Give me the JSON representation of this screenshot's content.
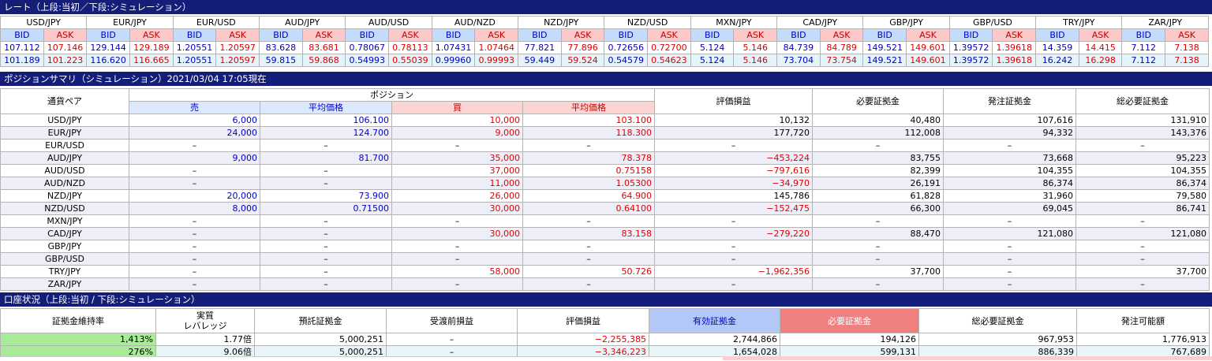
{
  "rates_section": {
    "title": "レート（上段:当初／下段:シミュレーション）"
  },
  "rate_labels": {
    "bid": "BID",
    "ask": "ASK"
  },
  "rates": [
    {
      "pair": "USD/JPY",
      "bid1": "107.112",
      "ask1": "107.146",
      "bid2": "101.189",
      "ask2": "101.223"
    },
    {
      "pair": "EUR/JPY",
      "bid1": "129.144",
      "ask1": "129.189",
      "bid2": "116.620",
      "ask2": "116.665"
    },
    {
      "pair": "EUR/USD",
      "bid1": "1.20551",
      "ask1": "1.20597",
      "bid2": "1.20551",
      "ask2": "1.20597"
    },
    {
      "pair": "AUD/JPY",
      "bid1": "83.628",
      "ask1": "83.681",
      "bid2": "59.815",
      "ask2": "59.868"
    },
    {
      "pair": "AUD/USD",
      "bid1": "0.78067",
      "ask1": "0.78113",
      "bid2": "0.54993",
      "ask2": "0.55039"
    },
    {
      "pair": "AUD/NZD",
      "bid1": "1.07431",
      "ask1": "1.07464",
      "bid2": "0.99960",
      "ask2": "0.99993"
    },
    {
      "pair": "NZD/JPY",
      "bid1": "77.821",
      "ask1": "77.896",
      "bid2": "59.449",
      "ask2": "59.524"
    },
    {
      "pair": "NZD/USD",
      "bid1": "0.72656",
      "ask1": "0.72700",
      "bid2": "0.54579",
      "ask2": "0.54623"
    },
    {
      "pair": "MXN/JPY",
      "bid1": "5.124",
      "ask1": "5.146",
      "bid2": "5.124",
      "ask2": "5.146"
    },
    {
      "pair": "CAD/JPY",
      "bid1": "84.739",
      "ask1": "84.789",
      "bid2": "73.704",
      "ask2": "73.754"
    },
    {
      "pair": "GBP/JPY",
      "bid1": "149.521",
      "ask1": "149.601",
      "bid2": "149.521",
      "ask2": "149.601"
    },
    {
      "pair": "GBP/USD",
      "bid1": "1.39572",
      "ask1": "1.39618",
      "bid2": "1.39572",
      "ask2": "1.39618"
    },
    {
      "pair": "TRY/JPY",
      "bid1": "14.359",
      "ask1": "14.415",
      "bid2": "16.242",
      "ask2": "16.298"
    },
    {
      "pair": "ZAR/JPY",
      "bid1": "7.112",
      "ask1": "7.138",
      "bid2": "7.112",
      "ask2": "7.138"
    }
  ],
  "position_section": {
    "title": "ポジションサマリ（シミュレーション）2021/03/04 17:05現在"
  },
  "position_headers": {
    "pair": "通貨ペア",
    "position": "ポジション",
    "sell": "売",
    "sell_avg": "平均価格",
    "buy": "買",
    "buy_avg": "平均価格",
    "pnl": "評価損益",
    "margin": "必要証拠金",
    "order_margin": "発注証拠金",
    "total_margin": "総必要証拠金"
  },
  "positions": [
    {
      "pair": "USD/JPY",
      "sell": "6,000",
      "sell_avg": "106.100",
      "buy": "10,000",
      "buy_avg": "103.100",
      "pnl": "10,132",
      "margin": "40,480",
      "order": "107,616",
      "total": "131,910"
    },
    {
      "pair": "EUR/JPY",
      "sell": "24,000",
      "sell_avg": "124.700",
      "buy": "9,000",
      "buy_avg": "118.300",
      "pnl": "177,720",
      "margin": "112,008",
      "order": "94,332",
      "total": "143,376"
    },
    {
      "pair": "EUR/USD",
      "sell": "–",
      "sell_avg": "–",
      "buy": "–",
      "buy_avg": "–",
      "pnl": "–",
      "margin": "–",
      "order": "–",
      "total": "–"
    },
    {
      "pair": "AUD/JPY",
      "sell": "9,000",
      "sell_avg": "81.700",
      "buy": "35,000",
      "buy_avg": "78.378",
      "pnl": "−453,224",
      "margin": "83,755",
      "order": "73,668",
      "total": "95,223"
    },
    {
      "pair": "AUD/USD",
      "sell": "–",
      "sell_avg": "–",
      "buy": "37,000",
      "buy_avg": "0.75158",
      "pnl": "−797,616",
      "margin": "82,399",
      "order": "104,355",
      "total": "104,355"
    },
    {
      "pair": "AUD/NZD",
      "sell": "–",
      "sell_avg": "–",
      "buy": "11,000",
      "buy_avg": "1.05300",
      "pnl": "−34,970",
      "margin": "26,191",
      "order": "86,374",
      "total": "86,374"
    },
    {
      "pair": "NZD/JPY",
      "sell": "20,000",
      "sell_avg": "73.900",
      "buy": "26,000",
      "buy_avg": "64.900",
      "pnl": "145,786",
      "margin": "61,828",
      "order": "31,960",
      "total": "79,580"
    },
    {
      "pair": "NZD/USD",
      "sell": "8,000",
      "sell_avg": "0.71500",
      "buy": "30,000",
      "buy_avg": "0.64100",
      "pnl": "−152,475",
      "margin": "66,300",
      "order": "69,045",
      "total": "86,741"
    },
    {
      "pair": "MXN/JPY",
      "sell": "–",
      "sell_avg": "–",
      "buy": "–",
      "buy_avg": "–",
      "pnl": "–",
      "margin": "–",
      "order": "–",
      "total": "–"
    },
    {
      "pair": "CAD/JPY",
      "sell": "–",
      "sell_avg": "–",
      "buy": "30,000",
      "buy_avg": "83.158",
      "pnl": "−279,220",
      "margin": "88,470",
      "order": "121,080",
      "total": "121,080"
    },
    {
      "pair": "GBP/JPY",
      "sell": "–",
      "sell_avg": "–",
      "buy": "–",
      "buy_avg": "–",
      "pnl": "–",
      "margin": "–",
      "order": "–",
      "total": "–"
    },
    {
      "pair": "GBP/USD",
      "sell": "–",
      "sell_avg": "–",
      "buy": "–",
      "buy_avg": "–",
      "pnl": "–",
      "margin": "–",
      "order": "–",
      "total": "–"
    },
    {
      "pair": "TRY/JPY",
      "sell": "–",
      "sell_avg": "–",
      "buy": "58,000",
      "buy_avg": "50.726",
      "pnl": "−1,962,356",
      "margin": "37,700",
      "order": "–",
      "total": "37,700"
    },
    {
      "pair": "ZAR/JPY",
      "sell": "–",
      "sell_avg": "–",
      "buy": "–",
      "buy_avg": "–",
      "pnl": "–",
      "margin": "–",
      "order": "–",
      "total": "–"
    }
  ],
  "account_section": {
    "title": "口座状況（上段:当初 / 下段:シミュレーション）"
  },
  "account_headers": {
    "maint_ratio": "証拠金維持率",
    "leverage_l1": "実質",
    "leverage_l2": "レバレッジ",
    "deposit": "預託証拠金",
    "unsettled": "受渡前損益",
    "pnl": "評価損益",
    "effective": "有効証拠金",
    "required": "必要証拠金",
    "total_required": "総必要証拠金",
    "orderable": "発注可能額"
  },
  "account_rows": [
    {
      "maint_ratio": "1,413%",
      "leverage": "1.77倍",
      "deposit": "5,000,251",
      "unsettled": "–",
      "pnl": "−2,255,385",
      "effective": "2,744,866",
      "required": "194,126",
      "total_required": "967,953",
      "orderable": "1,776,913"
    },
    {
      "maint_ratio": "276%",
      "leverage": "9.06倍",
      "deposit": "5,000,251",
      "unsettled": "–",
      "pnl": "−3,346,223",
      "effective": "1,654,028",
      "required": "599,131",
      "total_required": "886,339",
      "orderable": "767,689"
    }
  ],
  "colors": {
    "header_bar": "#141e78",
    "bid": "#c4dcfc",
    "ask": "#fcc8c8",
    "maint_highlight": "#a8ec98",
    "effective": "#b4c8f8",
    "required": "#f08080"
  }
}
